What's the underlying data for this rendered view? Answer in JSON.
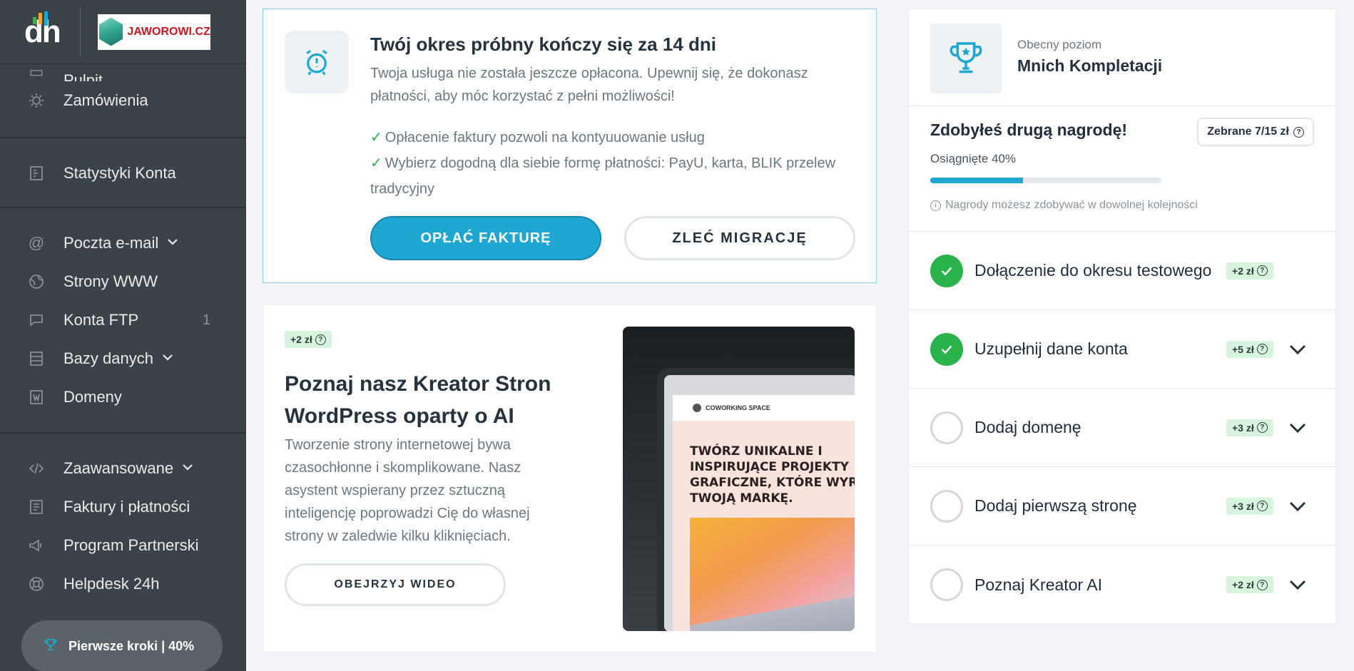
{
  "colors": {
    "sidebar_bg": "#3b4248",
    "accent": "#1ea7d2",
    "success": "#2bb34b",
    "badge_bg": "#d7f5de",
    "brand_red": "#c8161d"
  },
  "sidebar": {
    "logo_text": "dh",
    "brand_text": "JAWOROWI.CZ",
    "items": [
      {
        "label": "Pulpit",
        "icon": "dashboard-icon"
      },
      {
        "label": "Zamówienia",
        "icon": "bulb-icon"
      },
      {
        "label": "Statystyki Konta",
        "icon": "stats-icon"
      },
      {
        "label": "Poczta e-mail",
        "icon": "at-icon",
        "caret": true
      },
      {
        "label": "Strony WWW",
        "icon": "globe-icon"
      },
      {
        "label": "Konta FTP",
        "icon": "ftp-icon",
        "count": "1"
      },
      {
        "label": "Bazy danych",
        "icon": "database-icon",
        "caret": true
      },
      {
        "label": "Domeny",
        "icon": "domain-icon"
      },
      {
        "label": "Zaawansowane",
        "icon": "code-icon",
        "caret": true
      },
      {
        "label": "Faktury i płatności",
        "icon": "invoice-icon"
      },
      {
        "label": "Program Partnerski",
        "icon": "megaphone-icon"
      },
      {
        "label": "Helpdesk 24h",
        "icon": "lifebuoy-icon"
      }
    ],
    "first_steps": "Pierwsze kroki | 40%"
  },
  "trial": {
    "title": "Twój okres próbny kończy się za 14 dni",
    "description": "Twoja usługa nie została jeszcze opłacona. Upewnij się, że dokonasz płatności, aby móc korzystać z pełni możliwości!",
    "checks": [
      "Opłacenie faktury pozwoli na kontyuuowanie usług",
      "Wybierz dogodną dla siebie formę płatności: PayU, karta, BLIK przelew tradycyjny"
    ],
    "pay_button": "OPŁAĆ FAKTURĘ",
    "migrate_button": "ZLEĆ MIGRACJĘ"
  },
  "ai": {
    "badge": "+2 zł",
    "title": "Poznaj nasz Kreator Stron WordPress oparty o AI",
    "description": "Tworzenie strony internetowej bywa czasochłonne i skomplikowane. Nasz asystent wspierany przez sztuczną inteligencję poprowadzi Cię do własnej strony w zaledwie kilku kliknięciach.",
    "video_button": "OBEJRZYJ WIDEO",
    "preview_brand": "COWORKING SPACE",
    "preview_headline": "TWÓRZ UNIKALNE I INSPIRUJĄCE PROJEKTY GRAFICZNE, KTÓRE WYR TWOJĄ MARKĘ."
  },
  "progress_panel": {
    "level_label": "Obecny poziom",
    "level_name": "Mnich Kompletacji",
    "reward_title": "Zdobyłeś drugą nagrodę!",
    "collected": "Zebrane 7/15 zł",
    "progress_text": "Osiągnięte 40%",
    "progress_value": 0.4,
    "info_note": "Nagrody możesz zdobywać w dowolnej kolejności",
    "tasks": [
      {
        "label": "Dołączenie do okresu testowego",
        "badge": "+2 zł",
        "done": true,
        "expandable": false
      },
      {
        "label": "Uzupełnij dane konta",
        "badge": "+5 zł",
        "done": true,
        "expandable": true
      },
      {
        "label": "Dodaj domenę",
        "badge": "+3 zł",
        "done": false,
        "expandable": true
      },
      {
        "label": "Dodaj pierwszą stronę",
        "badge": "+3 zł",
        "done": false,
        "expandable": true
      },
      {
        "label": "Poznaj Kreator AI",
        "badge": "+2 zł",
        "done": false,
        "expandable": true
      }
    ]
  }
}
